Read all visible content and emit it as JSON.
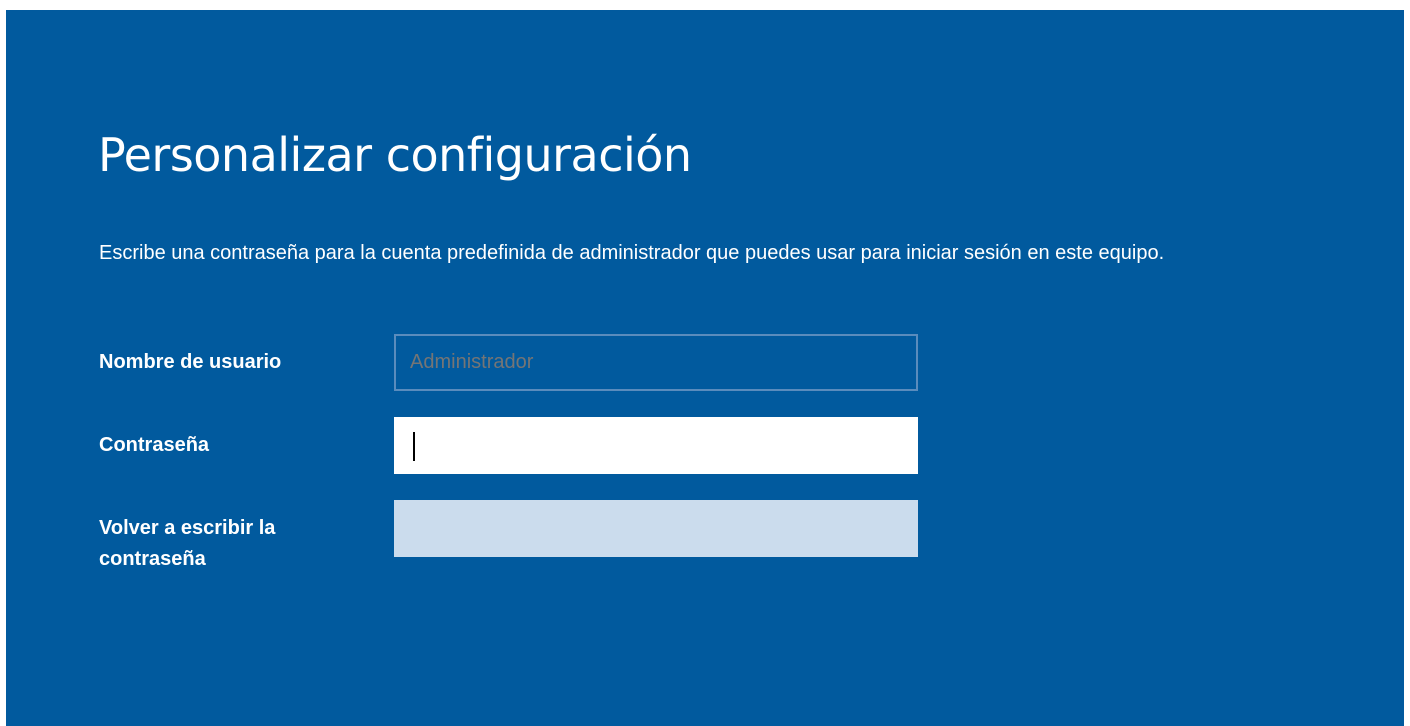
{
  "page": {
    "title": "Personalizar configuración",
    "description": "Escribe una contraseña para la cuenta predefinida de administrador que puedes usar para iniciar sesión en este equipo."
  },
  "form": {
    "username": {
      "label": "Nombre de usuario",
      "value": "",
      "placeholder": "Administrador",
      "disabled": true
    },
    "password": {
      "label": "Contraseña",
      "value": "",
      "focused": true
    },
    "confirm_password": {
      "label": "Volver a escribir la contraseña",
      "value": "",
      "disabled": true
    }
  },
  "colors": {
    "background": "#015a9e",
    "text": "#ffffff",
    "disabled_border": "#5a8cbd",
    "disabled_fill": "#cbdced"
  }
}
